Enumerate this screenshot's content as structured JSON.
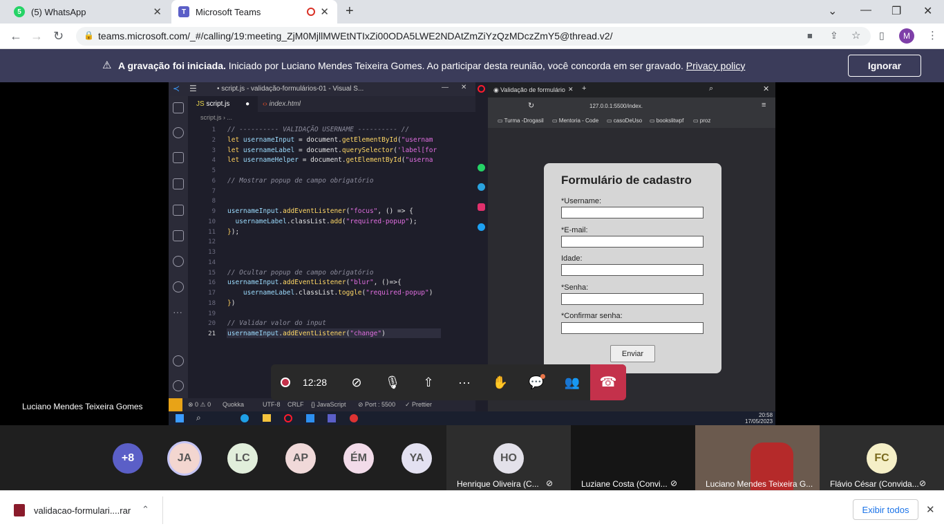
{
  "browser": {
    "tabs": [
      {
        "title": "(5) WhatsApp"
      },
      {
        "title": "Microsoft Teams"
      }
    ],
    "url": "teams.microsoft.com/_#/calling/19:meeting_ZjM0MjllMWEtNTIxZi00ODA5LWE2NDAtZmZiYzQzMDczZmY5@thread.v2/",
    "profile_initial": "M"
  },
  "banner": {
    "bold": "A gravação foi iniciada.",
    "text": " Iniciado por Luciano Mendes Teixeira Gomes. Ao participar desta reunião, você concorda em ser gravado. ",
    "link": "Privacy policy",
    "ignore_label": "Ignorar"
  },
  "vscode": {
    "window_title": "• script.js - validação-formulários-01 - Visual S...",
    "tab_active": "script.js",
    "tab_other": "index.html",
    "breadcrumb": "script.js › ...",
    "status": {
      "errors": "⊗ 0 ⚠ 0",
      "quokka": "Quokka",
      "encoding": "UTF-8",
      "eol": "CRLF",
      "lang": "{} JavaScript",
      "port": "⊘ Port : 5500",
      "prettier": "✓ Prettier"
    }
  },
  "shared_browser": {
    "tab_title": "Validação de formulário",
    "address": "127.0.0.1:5500/index.",
    "bookmarks": [
      "Turma -Drogasil",
      "Mentoria - Code",
      "casoDeUso",
      "bookslitwpf",
      "proz"
    ],
    "form": {
      "title": "Formulário de cadastro",
      "labels": [
        "*Username:",
        "*E-mail:",
        "Idade:",
        "*Senha:",
        "*Confirmar senha:"
      ],
      "submit": "Enviar"
    },
    "clock_time": "20:58",
    "clock_date": "17/05/2023"
  },
  "call": {
    "timer": "12:28",
    "presenter": "Luciano Mendes Teixeira Gomes"
  },
  "participants": {
    "overflow": "+8",
    "avatars": [
      {
        "initials": "JA",
        "color": "#f3d6d0"
      },
      {
        "initials": "LC",
        "color": "#e1eedb"
      },
      {
        "initials": "AP",
        "color": "#f0d9d9"
      },
      {
        "initials": "ÉM",
        "color": "#f2dbe9"
      },
      {
        "initials": "YA",
        "color": "#e3e1f1"
      }
    ],
    "tiles": [
      {
        "initials": "HO",
        "name": "Henrique Oliveira (C..."
      },
      {
        "name": "Luziane Costa (Convi..."
      },
      {
        "name": "Luciano Mendes Teixeira G..."
      },
      {
        "initials": "FC",
        "name": "Flávio César (Convida..."
      }
    ]
  },
  "download": {
    "filename": "validacao-formulari....rar",
    "show_all": "Exibir todos"
  }
}
